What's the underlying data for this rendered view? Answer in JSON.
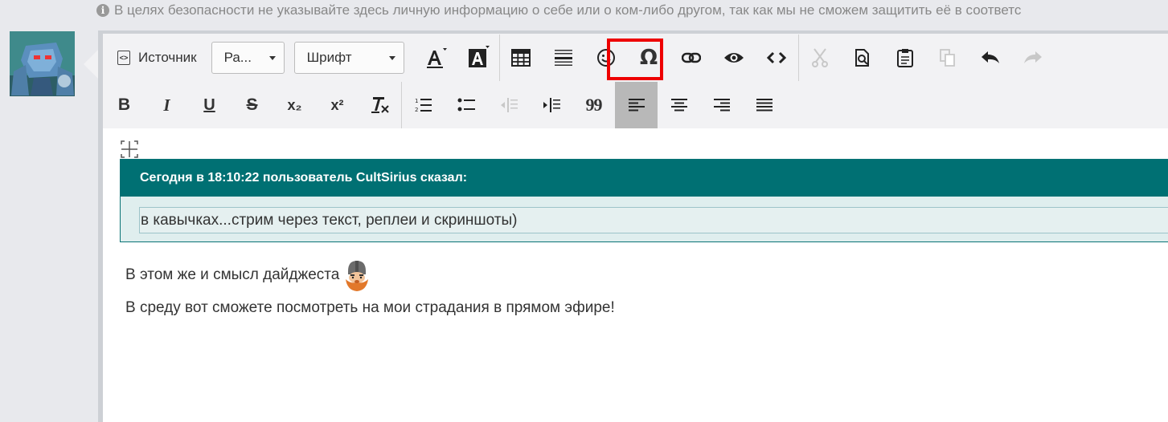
{
  "notice": {
    "icon": "info-icon",
    "text": "В целях безопасности не указывайте здесь личную информацию о себе или о ком-либо другом, так как мы не сможем защитить её в соответс"
  },
  "toolbar": {
    "source_label": "Источник",
    "format_combo": "Ра...",
    "font_combo": "Шрифт",
    "row1_buttons": [
      "text-color-icon",
      "background-color-icon",
      "table-icon",
      "horizontal-line-icon",
      "smiley-icon",
      "omega-icon",
      "link-icon",
      "eye-icon",
      "code-icon",
      "cut-icon",
      "paste-text-icon",
      "paste-icon",
      "copy-icon",
      "undo-icon",
      "redo-icon"
    ],
    "row2_buttons": [
      "bold-icon",
      "italic-icon",
      "underline-icon",
      "strikethrough-icon",
      "subscript-icon",
      "superscript-icon",
      "clear-format-icon",
      "ordered-list-icon",
      "bullet-list-icon",
      "outdent-icon",
      "indent-icon",
      "blockquote-icon",
      "align-left-icon",
      "align-center-icon",
      "align-right-icon",
      "justify-icon"
    ],
    "bold": "B",
    "italic": "I",
    "underline": "U",
    "strike": "S",
    "subscript": "x₂",
    "superscript": "x²",
    "omega": "Ω",
    "quote_marks": "99",
    "highlight_color": "#ee0000"
  },
  "quote": {
    "header": "Сегодня в 18:10:22 пользователь CultSirius сказал:",
    "body": "в кавычках...стрим через текст, реплеи и скриншоты)"
  },
  "paragraphs": {
    "line1": "В этом же и смысл дайджеста",
    "line2": "В среду вот сможете посмотреть на мои страдания в прямом эфире!"
  },
  "colors": {
    "quote_header_bg": "#007073",
    "quote_body_bg": "#e5f0f0",
    "toolbar_bg": "#f2f2f4"
  }
}
